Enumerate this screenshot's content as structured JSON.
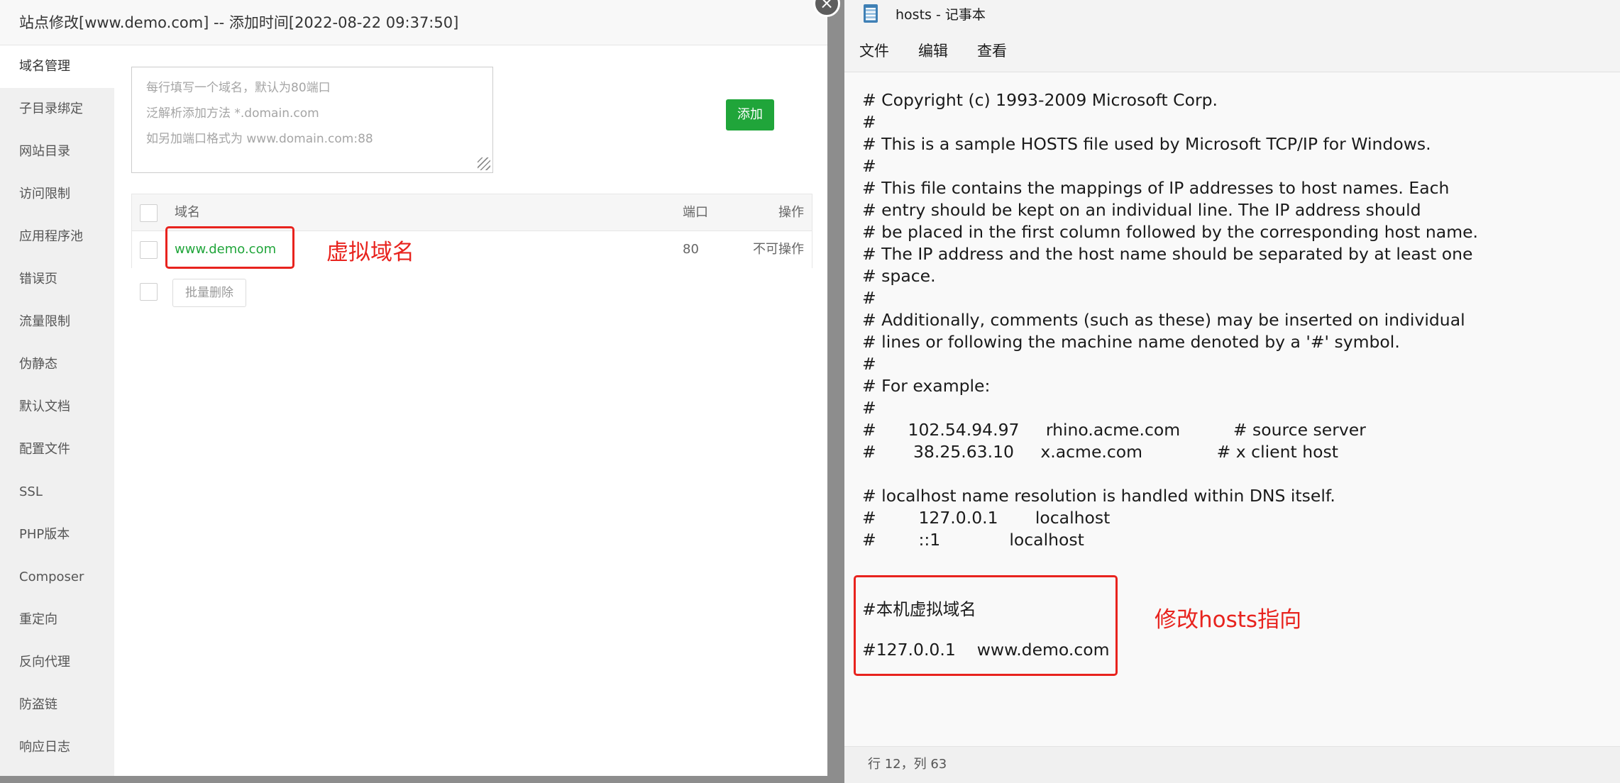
{
  "left_panel": {
    "title": "站点修改[www.demo.com] -- 添加时间[2022-08-22 09:37:50]",
    "close_icon": "×",
    "sidebar": {
      "items": [
        {
          "label": "域名管理",
          "active": true
        },
        {
          "label": "子目录绑定"
        },
        {
          "label": "网站目录"
        },
        {
          "label": "访问限制"
        },
        {
          "label": "应用程序池"
        },
        {
          "label": "错误页"
        },
        {
          "label": "流量限制"
        },
        {
          "label": "伪静态"
        },
        {
          "label": "默认文档"
        },
        {
          "label": "配置文件"
        },
        {
          "label": "SSL"
        },
        {
          "label": "PHP版本"
        },
        {
          "label": "Composer"
        },
        {
          "label": "重定向"
        },
        {
          "label": "反向代理"
        },
        {
          "label": "防盗链"
        },
        {
          "label": "响应日志"
        }
      ]
    },
    "domain_input": {
      "placeholder_lines": [
        "每行填写一个域名，默认为80端口",
        "泛解析添加方法 *.domain.com",
        "如另加端口格式为 www.domain.com:88"
      ]
    },
    "add_label": "添加",
    "table": {
      "headers": {
        "domain": "域名",
        "port": "端口",
        "action": "操作"
      },
      "rows": [
        {
          "domain": "www.demo.com",
          "port": "80",
          "action": "不可操作"
        }
      ]
    },
    "batch_delete_label": "批量删除",
    "annotation": "虚拟域名",
    "colors": {
      "accent_green": "#20a53a",
      "annotation_red": "#e8231e"
    }
  },
  "notepad": {
    "title": "hosts - 记事本",
    "icon": "notepad-icon",
    "menu": [
      "文件",
      "编辑",
      "查看"
    ],
    "lines": [
      "# Copyright (c) 1993-2009 Microsoft Corp.",
      "#",
      "# This is a sample HOSTS file used by Microsoft TCP/IP for Windows.",
      "#",
      "# This file contains the mappings of IP addresses to host names. Each",
      "# entry should be kept on an individual line. The IP address should",
      "# be placed in the first column followed by the corresponding host name.",
      "# The IP address and the host name should be separated by at least one",
      "# space.",
      "#",
      "# Additionally, comments (such as these) may be inserted on individual",
      "# lines or following the machine name denoted by a '#' symbol.",
      "#",
      "# For example:",
      "#",
      "#      102.54.94.97     rhino.acme.com          # source server",
      "#       38.25.63.10     x.acme.com              # x client host",
      "",
      "# localhost name resolution is handled within DNS itself.",
      "#        127.0.0.1       localhost",
      "#        ::1             localhost",
      "",
      "",
      "#本机虚拟域名",
      "",
      "#127.0.0.1    www.demo.com"
    ],
    "status": "行 12，列 63",
    "annotation": "修改hosts指向"
  }
}
